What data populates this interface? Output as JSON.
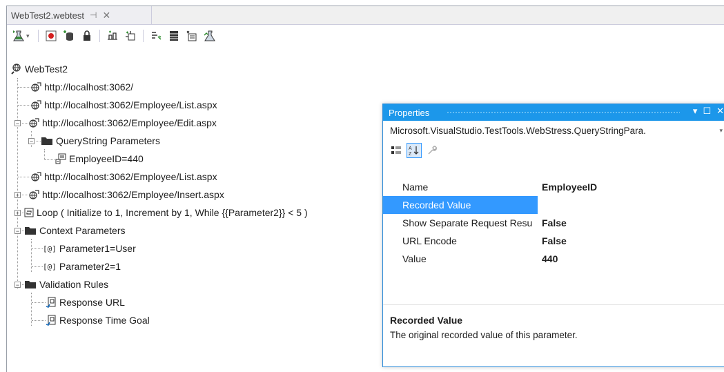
{
  "document": {
    "tab_title": "WebTest2.webtest",
    "tab_pin": "⊣",
    "tab_close": "✕"
  },
  "tree": {
    "root": "WebTest2",
    "items": [
      {
        "label": "http://localhost:3062/"
      },
      {
        "label": "http://localhost:3062/Employee/List.aspx"
      },
      {
        "label": "http://localhost:3062/Employee/Edit.aspx",
        "expander": "−"
      },
      {
        "label": "QueryString Parameters",
        "expander": "−"
      },
      {
        "label": "EmployeeID=440"
      },
      {
        "label": "http://localhost:3062/Employee/List.aspx"
      },
      {
        "label": "http://localhost:3062/Employee/Insert.aspx",
        "expander": "+"
      },
      {
        "label": "Loop ( Initialize to 1, Increment by 1, While {{Parameter2}} < 5 )",
        "expander": "+"
      },
      {
        "label": "Context Parameters",
        "expander": "−"
      },
      {
        "label": "Parameter1=User"
      },
      {
        "label": "Parameter2=1"
      },
      {
        "label": "Validation Rules",
        "expander": "−"
      },
      {
        "label": "Response URL"
      },
      {
        "label": "Response Time Goal"
      }
    ]
  },
  "properties": {
    "title": "Properties",
    "window_controls": [
      "▾",
      "☐",
      "✕"
    ],
    "object_selector": "Microsoft.VisualStudio.TestTools.WebStress.QueryStringPara.",
    "selector_arrow": "▾",
    "rows": [
      {
        "name": "Name",
        "value": "EmployeeID"
      },
      {
        "name": "Recorded Value",
        "value": ""
      },
      {
        "name": "Show Separate Request Resu",
        "value": "False"
      },
      {
        "name": "URL Encode",
        "value": "False"
      },
      {
        "name": "Value",
        "value": "440"
      }
    ],
    "description_title": "Recorded Value",
    "description_text": "The original recorded value of this parameter."
  },
  "colors": {
    "accent": "#1c97ea",
    "selection": "#3399ff"
  }
}
